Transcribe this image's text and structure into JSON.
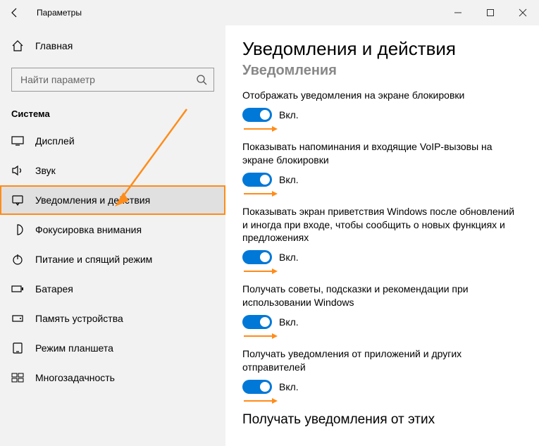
{
  "window": {
    "title": "Параметры"
  },
  "sidebar": {
    "home": "Главная",
    "search_placeholder": "Найти параметр",
    "section": "Система",
    "items": [
      {
        "label": "Дисплей"
      },
      {
        "label": "Звук"
      },
      {
        "label": "Уведомления и действия"
      },
      {
        "label": "Фокусировка внимания"
      },
      {
        "label": "Питание и спящий режим"
      },
      {
        "label": "Батарея"
      },
      {
        "label": "Память устройства"
      },
      {
        "label": "Режим планшета"
      },
      {
        "label": "Многозадачность"
      }
    ]
  },
  "content": {
    "title": "Уведомления и действия",
    "subhead": "Уведомления",
    "toggle_on": "Вкл.",
    "options": [
      {
        "label": "Отображать уведомления на экране блокировки"
      },
      {
        "label": "Показывать напоминания и входящие VoIP-вызовы на экране блокировки"
      },
      {
        "label": "Показывать экран приветствия Windows после обновлений и иногда при входе, чтобы сообщить о новых функциях и предложениях"
      },
      {
        "label": "Получать советы, подсказки и рекомендации при использовании Windows"
      },
      {
        "label": "Получать уведомления от приложений и других отправителей"
      }
    ],
    "footer_heading": "Получать уведомления от этих"
  }
}
